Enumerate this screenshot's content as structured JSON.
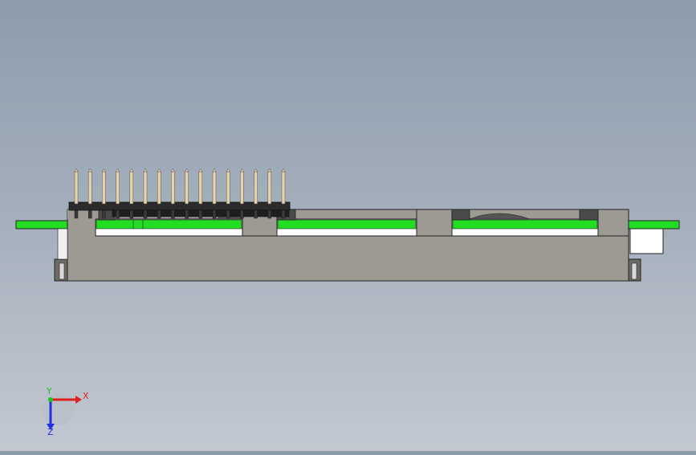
{
  "viewport": {
    "background_top": "#8d9cad",
    "background_bottom": "#c3c8d1"
  },
  "model": {
    "pcb_color": "#22dd22",
    "body_color": "#9c9a92",
    "header_pin_color": "#e8d2a8",
    "header_plastic_color": "#2b2b2b",
    "pin_count_visible": 16
  },
  "triad": {
    "x_label": "X",
    "y_label": "Y",
    "z_label": "Z",
    "x_color": "#e02020",
    "y_color": "#20c020",
    "z_color": "#2030e0"
  }
}
